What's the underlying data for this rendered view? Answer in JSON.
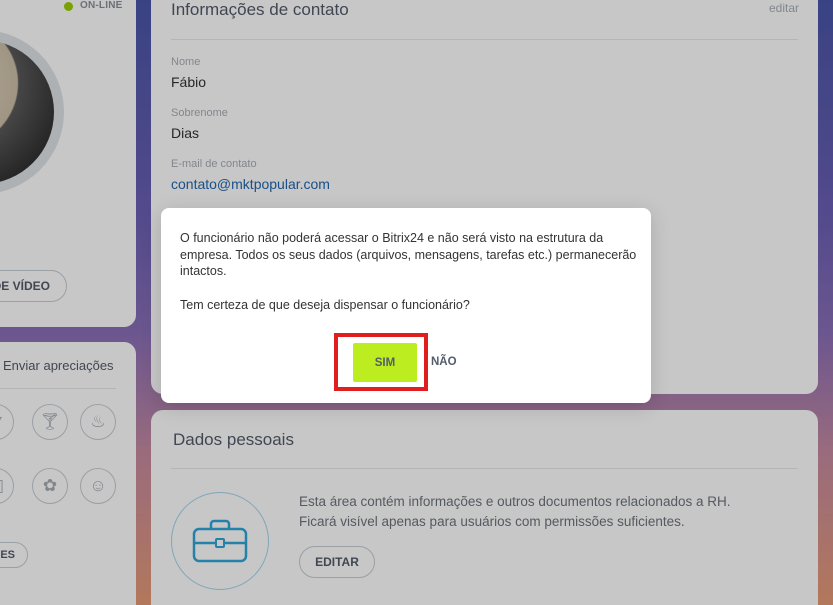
{
  "profile": {
    "status": "ON-LINE",
    "video_button": "DA DE VÍDEO"
  },
  "appreciation": {
    "title": "Enviar apreciações",
    "partial_button": "ES"
  },
  "contact": {
    "title": "Informações de contato",
    "edit_label": "editar",
    "fields": [
      {
        "label": "Nome",
        "value": "Fábio"
      },
      {
        "label": "Sobrenome",
        "value": "Dias"
      },
      {
        "label": "E-mail de contato",
        "value": "contato@mktpopular.com"
      }
    ]
  },
  "personal": {
    "title": "Dados pessoais",
    "description_line1": "Esta área contém informações e outros documentos relacionados a RH.",
    "description_line2": "Ficará visível apenas para usuários com permissões suficientes.",
    "edit_button": "EDITAR"
  },
  "dialog": {
    "message": "O funcionário não poderá acessar o Bitrix24 e não será visto na estrutura da empresa. Todos os seus dados (arquivos, mensagens, tarefas etc.) permanecerão intactos.",
    "question": "Tem certeza de que deseja dispensar o funcionário?",
    "confirm_label": "SIM",
    "cancel_label": "NÃO"
  },
  "colors": {
    "accent_green": "#bbed21",
    "online_green": "#9dcf00",
    "highlight_red": "#e01e1e",
    "link_blue": "#2067b0"
  }
}
